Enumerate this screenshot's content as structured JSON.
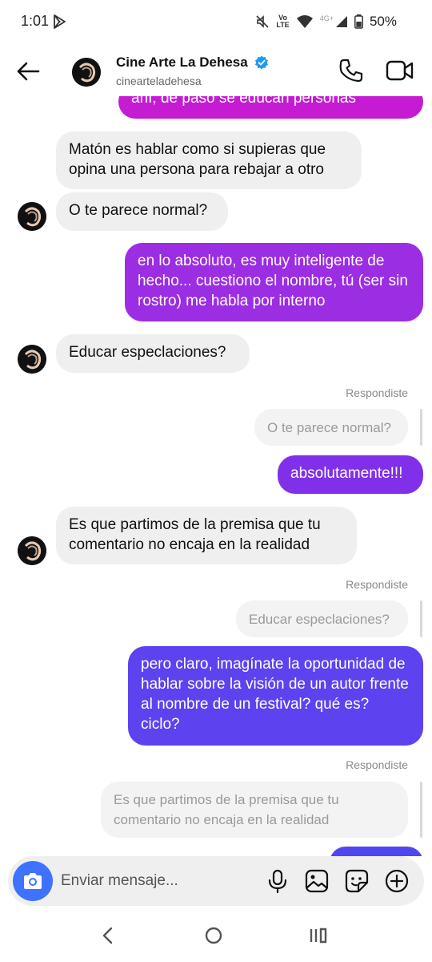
{
  "status": {
    "time": "1:01",
    "volte_top": "Vo",
    "volte_bottom": "LTE",
    "net": "4G+",
    "battery": "50%"
  },
  "header": {
    "name": "Cine Arte La Dehesa",
    "handle": "cinearteladehesa"
  },
  "messages": {
    "m0": "ahí, de paso se educan personas",
    "m1": "Matón es hablar como si supieras que opina una persona para rebajar a otro",
    "m2": "O te parece normal?",
    "m3": "en lo absoluto, es muy inteligente de hecho... cuestiono el nombre, tú (ser sin rostro) me habla por interno",
    "m4": "Educar especlaciones?",
    "r1_label": "Respondiste",
    "r1_quote": "O te parece normal?",
    "m5": "absolutamente!!!",
    "m6": "Es que partimos de la premisa que tu comentario no encaja en la realidad",
    "r2_label": "Respondiste",
    "r2_quote": "Educar especlaciones?",
    "m7": "pero claro, imagínate la oportunidad de hablar sobre la visión de un autor frente al nombre de un festival? qué es? ciclo?",
    "r3_label": "Respondiste",
    "r3_quote": "Es que partimos de la premisa que tu comentario no encaja en la realidad"
  },
  "composer": {
    "placeholder": "Enviar mensaje..."
  },
  "icons": {
    "back": "back-arrow-icon",
    "verified": "verified-badge-icon",
    "phone": "phone-icon",
    "video": "video-icon",
    "camera": "camera-icon",
    "mic": "microphone-icon",
    "gallery": "gallery-icon",
    "sticker": "sticker-icon",
    "plus": "plus-circle-icon"
  },
  "colors": {
    "out_magenta": "#c41bd3",
    "out_purple": "#9b2de3",
    "out_violet": "#8030e8",
    "out_indigo": "#5d42f0",
    "accent_blue": "#3f72ff",
    "verified": "#1d9bf0"
  }
}
